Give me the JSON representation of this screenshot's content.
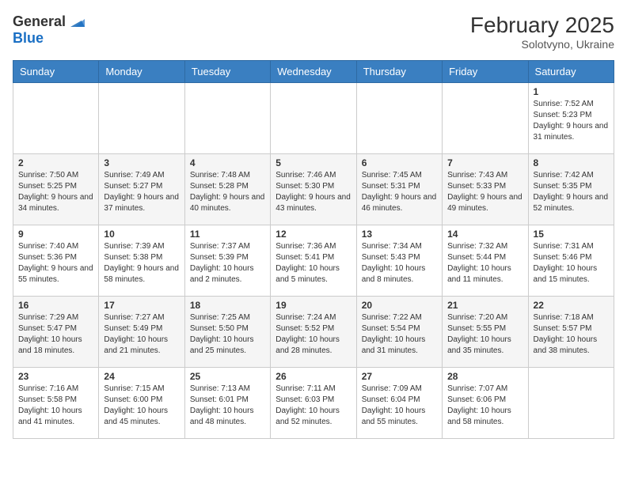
{
  "header": {
    "logo": {
      "general": "General",
      "blue": "Blue"
    },
    "title": "February 2025",
    "location": "Solotvyno, Ukraine"
  },
  "weekdays": [
    "Sunday",
    "Monday",
    "Tuesday",
    "Wednesday",
    "Thursday",
    "Friday",
    "Saturday"
  ],
  "weeks": [
    [
      {
        "day": "",
        "info": ""
      },
      {
        "day": "",
        "info": ""
      },
      {
        "day": "",
        "info": ""
      },
      {
        "day": "",
        "info": ""
      },
      {
        "day": "",
        "info": ""
      },
      {
        "day": "",
        "info": ""
      },
      {
        "day": "1",
        "info": "Sunrise: 7:52 AM\nSunset: 5:23 PM\nDaylight: 9 hours and 31 minutes."
      }
    ],
    [
      {
        "day": "2",
        "info": "Sunrise: 7:50 AM\nSunset: 5:25 PM\nDaylight: 9 hours and 34 minutes."
      },
      {
        "day": "3",
        "info": "Sunrise: 7:49 AM\nSunset: 5:27 PM\nDaylight: 9 hours and 37 minutes."
      },
      {
        "day": "4",
        "info": "Sunrise: 7:48 AM\nSunset: 5:28 PM\nDaylight: 9 hours and 40 minutes."
      },
      {
        "day": "5",
        "info": "Sunrise: 7:46 AM\nSunset: 5:30 PM\nDaylight: 9 hours and 43 minutes."
      },
      {
        "day": "6",
        "info": "Sunrise: 7:45 AM\nSunset: 5:31 PM\nDaylight: 9 hours and 46 minutes."
      },
      {
        "day": "7",
        "info": "Sunrise: 7:43 AM\nSunset: 5:33 PM\nDaylight: 9 hours and 49 minutes."
      },
      {
        "day": "8",
        "info": "Sunrise: 7:42 AM\nSunset: 5:35 PM\nDaylight: 9 hours and 52 minutes."
      }
    ],
    [
      {
        "day": "9",
        "info": "Sunrise: 7:40 AM\nSunset: 5:36 PM\nDaylight: 9 hours and 55 minutes."
      },
      {
        "day": "10",
        "info": "Sunrise: 7:39 AM\nSunset: 5:38 PM\nDaylight: 9 hours and 58 minutes."
      },
      {
        "day": "11",
        "info": "Sunrise: 7:37 AM\nSunset: 5:39 PM\nDaylight: 10 hours and 2 minutes."
      },
      {
        "day": "12",
        "info": "Sunrise: 7:36 AM\nSunset: 5:41 PM\nDaylight: 10 hours and 5 minutes."
      },
      {
        "day": "13",
        "info": "Sunrise: 7:34 AM\nSunset: 5:43 PM\nDaylight: 10 hours and 8 minutes."
      },
      {
        "day": "14",
        "info": "Sunrise: 7:32 AM\nSunset: 5:44 PM\nDaylight: 10 hours and 11 minutes."
      },
      {
        "day": "15",
        "info": "Sunrise: 7:31 AM\nSunset: 5:46 PM\nDaylight: 10 hours and 15 minutes."
      }
    ],
    [
      {
        "day": "16",
        "info": "Sunrise: 7:29 AM\nSunset: 5:47 PM\nDaylight: 10 hours and 18 minutes."
      },
      {
        "day": "17",
        "info": "Sunrise: 7:27 AM\nSunset: 5:49 PM\nDaylight: 10 hours and 21 minutes."
      },
      {
        "day": "18",
        "info": "Sunrise: 7:25 AM\nSunset: 5:50 PM\nDaylight: 10 hours and 25 minutes."
      },
      {
        "day": "19",
        "info": "Sunrise: 7:24 AM\nSunset: 5:52 PM\nDaylight: 10 hours and 28 minutes."
      },
      {
        "day": "20",
        "info": "Sunrise: 7:22 AM\nSunset: 5:54 PM\nDaylight: 10 hours and 31 minutes."
      },
      {
        "day": "21",
        "info": "Sunrise: 7:20 AM\nSunset: 5:55 PM\nDaylight: 10 hours and 35 minutes."
      },
      {
        "day": "22",
        "info": "Sunrise: 7:18 AM\nSunset: 5:57 PM\nDaylight: 10 hours and 38 minutes."
      }
    ],
    [
      {
        "day": "23",
        "info": "Sunrise: 7:16 AM\nSunset: 5:58 PM\nDaylight: 10 hours and 41 minutes."
      },
      {
        "day": "24",
        "info": "Sunrise: 7:15 AM\nSunset: 6:00 PM\nDaylight: 10 hours and 45 minutes."
      },
      {
        "day": "25",
        "info": "Sunrise: 7:13 AM\nSunset: 6:01 PM\nDaylight: 10 hours and 48 minutes."
      },
      {
        "day": "26",
        "info": "Sunrise: 7:11 AM\nSunset: 6:03 PM\nDaylight: 10 hours and 52 minutes."
      },
      {
        "day": "27",
        "info": "Sunrise: 7:09 AM\nSunset: 6:04 PM\nDaylight: 10 hours and 55 minutes."
      },
      {
        "day": "28",
        "info": "Sunrise: 7:07 AM\nSunset: 6:06 PM\nDaylight: 10 hours and 58 minutes."
      },
      {
        "day": "",
        "info": ""
      }
    ]
  ]
}
